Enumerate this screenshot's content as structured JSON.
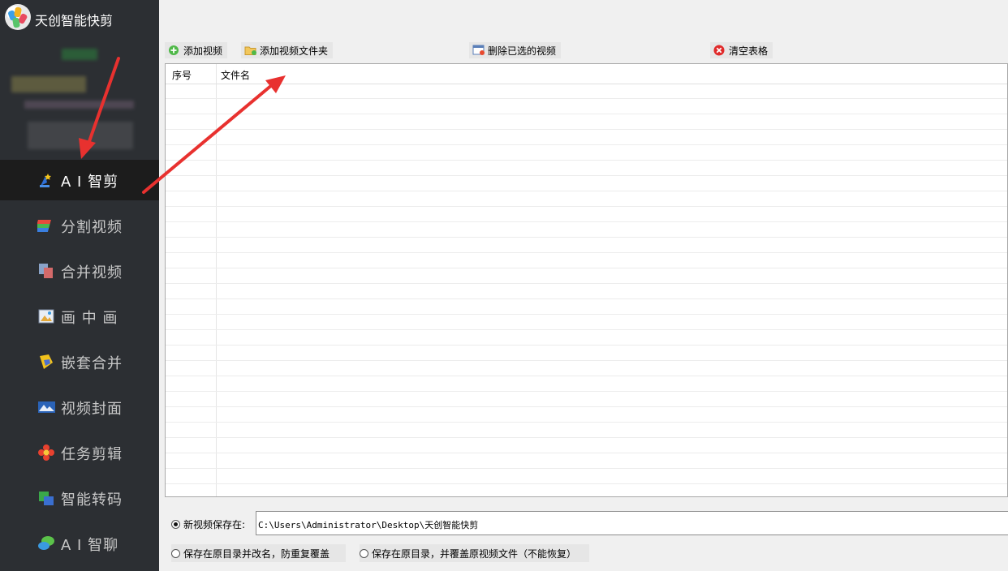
{
  "app": {
    "title": "天创智能快剪"
  },
  "sidebar": {
    "items": [
      {
        "label": "A I 智剪",
        "icon": "ai-cut-icon",
        "active": true
      },
      {
        "label": "分割视频",
        "icon": "split-video-icon"
      },
      {
        "label": "合并视频",
        "icon": "merge-video-icon"
      },
      {
        "label": "画 中 画",
        "icon": "picture-in-picture-icon"
      },
      {
        "label": "嵌套合并",
        "icon": "nested-merge-icon"
      },
      {
        "label": "视频封面",
        "icon": "video-cover-icon"
      },
      {
        "label": "任务剪辑",
        "icon": "task-edit-icon"
      },
      {
        "label": "智能转码",
        "icon": "transcode-icon"
      },
      {
        "label": "A I 智聊",
        "icon": "ai-chat-icon"
      }
    ]
  },
  "toolbar": {
    "add_video": "添加视频",
    "add_folder": "添加视频文件夹",
    "delete_selected": "删除已选的视频",
    "clear_table": "清空表格"
  },
  "table": {
    "columns": [
      "序号",
      "文件名"
    ],
    "rows": []
  },
  "output": {
    "new_save_label": "新视频保存在:",
    "path": "C:\\Users\\Administrator\\Desktop\\天创智能快剪",
    "rename_label": "保存在原目录并改名，防重复覆盖",
    "overwrite_label": "保存在原目录，并覆盖原视频文件（不能恢复）",
    "selected": "new_save"
  },
  "colors": {
    "sidebar_bg": "#2c2f33",
    "active_bg": "#1c1c1c",
    "annotation_arrow": "#e8312f"
  }
}
